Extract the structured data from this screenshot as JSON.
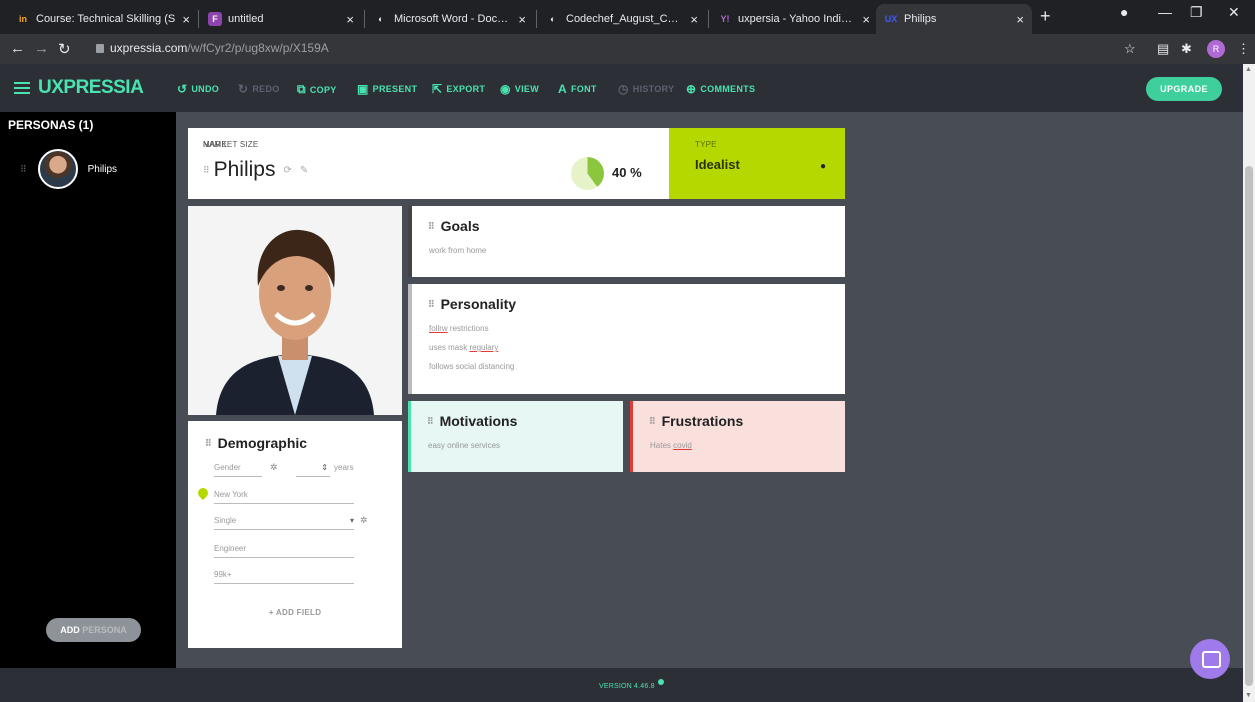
{
  "browser": {
    "tabs": [
      {
        "title": "Course: Technical Skilling (S",
        "favicon": "in",
        "favicon_color": "#f5a623"
      },
      {
        "title": "untitled",
        "favicon": "F",
        "favicon_color": "#8e44ad"
      },
      {
        "title": "Microsoft Word - Documen",
        "favicon": "◐",
        "favicon_color": "#e8eaed"
      },
      {
        "title": "Codechef_August_Challang",
        "favicon": "◐",
        "favicon_color": "#e8eaed"
      },
      {
        "title": "uxpersia - Yahoo India Sear",
        "favicon": "Y!",
        "favicon_color": "#7b1fa2"
      },
      {
        "title": "Philips",
        "favicon": "UX",
        "favicon_color": "#3d5afe"
      }
    ],
    "close_glyph": "×",
    "new_tab_glyph": "+",
    "url_host": "uxpressia.com",
    "url_path": "/w/fCyr2/p/ug8xw/p/X159A",
    "profile_initial": "R"
  },
  "app": {
    "logo": "UXPRESSIA",
    "toolbar": {
      "undo": "UNDO",
      "redo": "REDO",
      "copy": "COPY",
      "present": "PRESENT",
      "export": "EXPORT",
      "view": "VIEW",
      "font": "FONT",
      "history": "HISTORY",
      "comments": "COMMENTS"
    },
    "upgrade": "UPGRADE",
    "accent_color": "#49e3b0"
  },
  "sidebar": {
    "title": "PERSONAS (1)",
    "persona_name": "Philips",
    "add_persona_main": "ADD",
    "add_persona_lite": "PERSONA"
  },
  "persona": {
    "name_label": "NAME",
    "name": "Philips",
    "market_size_label": "MARKET SIZE",
    "market_size_value": "40 %",
    "market_size_fraction": 0.4,
    "type_label": "TYPE",
    "type_value": "Idealist",
    "type_color": "#b5d800"
  },
  "goals": {
    "title": "Goals",
    "items": [
      "work from home"
    ]
  },
  "personality": {
    "title": "Personality",
    "line1_err": "follrw",
    "line1_rest": "restrictions",
    "line2_start": "uses mask",
    "line2_err": "regulary",
    "line3": "follows social distancing"
  },
  "motivations": {
    "title": "Motivations",
    "items": [
      "easy online services"
    ],
    "color": "#49e3b0"
  },
  "frustrations": {
    "title": "Frustrations",
    "line_start": "Hates",
    "line_err": "covid",
    "color": "#e53935"
  },
  "demographic": {
    "title": "Demographic",
    "gender_placeholder": "Gender",
    "years_label": "years",
    "location": "New York",
    "status": "Single",
    "occupation": "Engineer",
    "income": "99k+",
    "add_field": "+ ADD FIELD"
  },
  "footer": {
    "version": "VERSION 4.46.8"
  }
}
